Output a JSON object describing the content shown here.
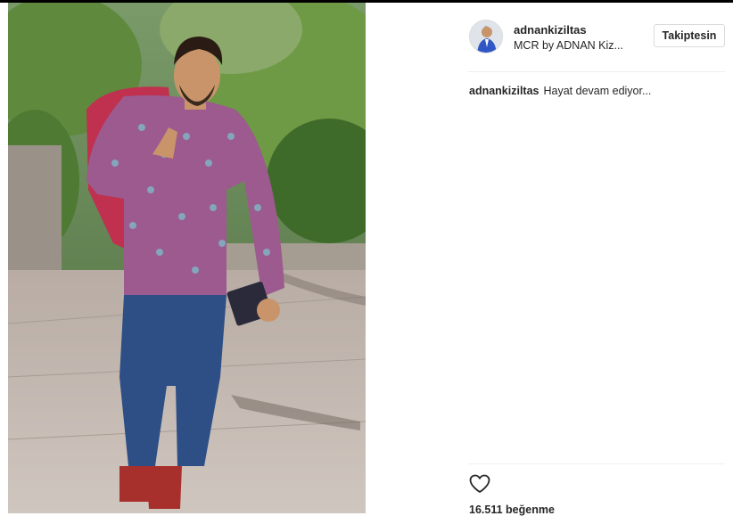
{
  "post": {
    "image_alt": "Man in patterned shirt and jeans walking with a pink jacket over his shoulder",
    "author": {
      "username": "adnankiziltas",
      "location": "MCR by ADNAN Kiz..."
    },
    "follow_button_label": "Takiptesin",
    "caption": {
      "username": "adnankiziltas",
      "text": "Hayat devam ediyor..."
    },
    "likes_text": "16.511 beğenme"
  },
  "icons": {
    "like": "heart-outline-icon"
  },
  "colors": {
    "text": "#262626",
    "divider": "#efefef",
    "button_border": "#dbdbdb"
  }
}
